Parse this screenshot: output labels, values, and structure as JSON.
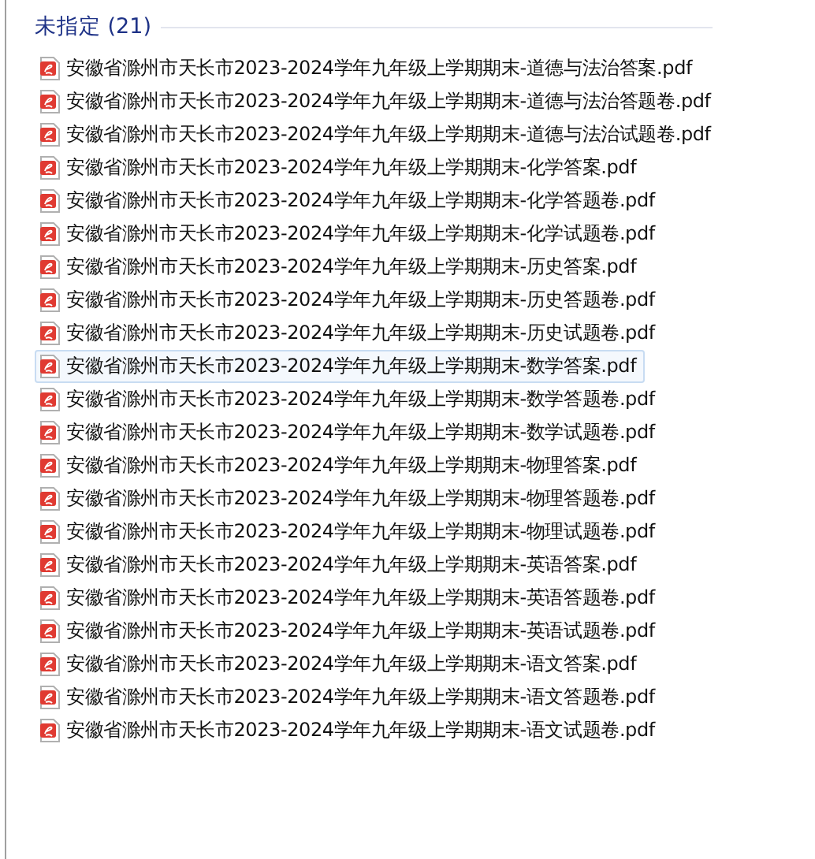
{
  "group": {
    "title": "未指定 (21)"
  },
  "files": [
    {
      "name": "安徽省滁州市天长市2023-2024学年九年级上学期期末-道德与法治答案.pdf",
      "selected": false
    },
    {
      "name": "安徽省滁州市天长市2023-2024学年九年级上学期期末-道德与法治答题卷.pdf",
      "selected": false
    },
    {
      "name": "安徽省滁州市天长市2023-2024学年九年级上学期期末-道德与法治试题卷.pdf",
      "selected": false
    },
    {
      "name": "安徽省滁州市天长市2023-2024学年九年级上学期期末-化学答案.pdf",
      "selected": false
    },
    {
      "name": "安徽省滁州市天长市2023-2024学年九年级上学期期末-化学答题卷.pdf",
      "selected": false
    },
    {
      "name": "安徽省滁州市天长市2023-2024学年九年级上学期期末-化学试题卷.pdf",
      "selected": false
    },
    {
      "name": "安徽省滁州市天长市2023-2024学年九年级上学期期末-历史答案.pdf",
      "selected": false
    },
    {
      "name": "安徽省滁州市天长市2023-2024学年九年级上学期期末-历史答题卷.pdf",
      "selected": false
    },
    {
      "name": "安徽省滁州市天长市2023-2024学年九年级上学期期末-历史试题卷.pdf",
      "selected": false
    },
    {
      "name": "安徽省滁州市天长市2023-2024学年九年级上学期期末-数学答案.pdf",
      "selected": true
    },
    {
      "name": "安徽省滁州市天长市2023-2024学年九年级上学期期末-数学答题卷.pdf",
      "selected": false
    },
    {
      "name": "安徽省滁州市天长市2023-2024学年九年级上学期期末-数学试题卷.pdf",
      "selected": false
    },
    {
      "name": "安徽省滁州市天长市2023-2024学年九年级上学期期末-物理答案.pdf",
      "selected": false
    },
    {
      "name": "安徽省滁州市天长市2023-2024学年九年级上学期期末-物理答题卷.pdf",
      "selected": false
    },
    {
      "name": "安徽省滁州市天长市2023-2024学年九年级上学期期末-物理试题卷.pdf",
      "selected": false
    },
    {
      "name": "安徽省滁州市天长市2023-2024学年九年级上学期期末-英语答案.pdf",
      "selected": false
    },
    {
      "name": "安徽省滁州市天长市2023-2024学年九年级上学期期末-英语答题卷.pdf",
      "selected": false
    },
    {
      "name": "安徽省滁州市天长市2023-2024学年九年级上学期期末-英语试题卷.pdf",
      "selected": false
    },
    {
      "name": "安徽省滁州市天长市2023-2024学年九年级上学期期末-语文答案.pdf",
      "selected": false
    },
    {
      "name": "安徽省滁州市天长市2023-2024学年九年级上学期期末-语文答题卷.pdf",
      "selected": false
    },
    {
      "name": "安徽省滁州市天长市2023-2024学年九年级上学期期末-语文试题卷.pdf",
      "selected": false
    }
  ]
}
